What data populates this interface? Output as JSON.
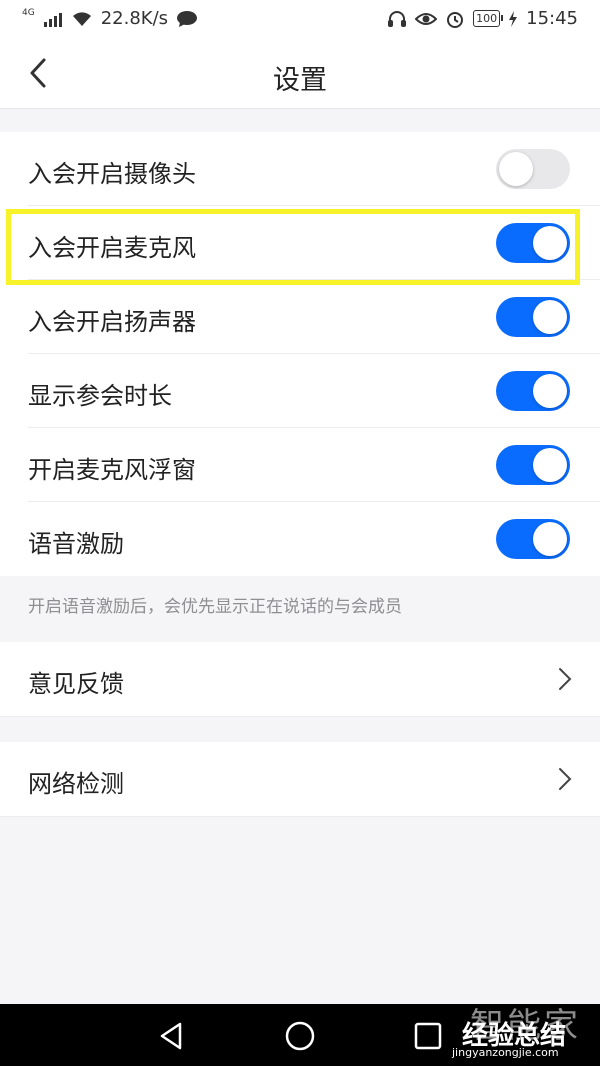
{
  "status_bar": {
    "network_tag": "4G",
    "speed": "22.8K/s",
    "battery": "100",
    "time": "15:45"
  },
  "nav": {
    "title": "设置"
  },
  "settings": {
    "toggles": [
      {
        "label": "入会开启摄像头",
        "on": false
      },
      {
        "label": "入会开启麦克风",
        "on": true
      },
      {
        "label": "入会开启扬声器",
        "on": true
      },
      {
        "label": "显示参会时长",
        "on": true
      },
      {
        "label": "开启麦克风浮窗",
        "on": true
      },
      {
        "label": "语音激励",
        "on": true
      }
    ],
    "hint": "开启语音激励后，会优先显示正在说话的与会成员"
  },
  "links": [
    {
      "label": "意见反馈"
    },
    {
      "label": "网络检测"
    }
  ],
  "colors": {
    "accent": "#0a6cff",
    "highlight": "#f8f22a",
    "background": "#f5f5f7"
  },
  "watermark": {
    "line1": "智能家",
    "line2": "经验总结",
    "line3": "jingyanzongjie.com"
  }
}
